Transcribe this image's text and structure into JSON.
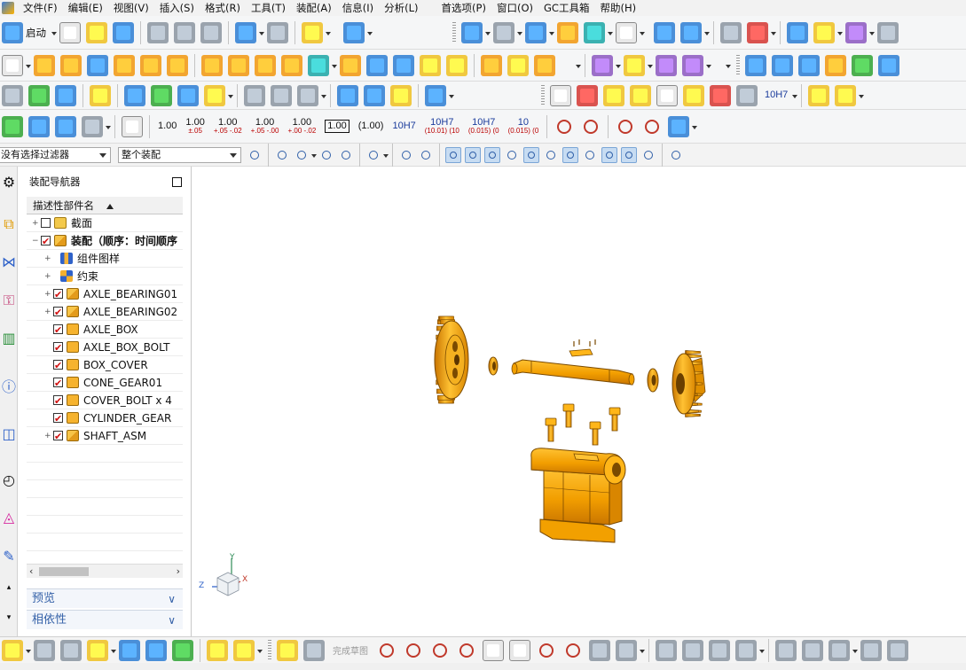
{
  "menu": {
    "items": [
      "文件(F)",
      "编辑(E)",
      "视图(V)",
      "插入(S)",
      "格式(R)",
      "工具(T)",
      "装配(A)",
      "信息(I)",
      "分析(L)",
      "首选项(P)",
      "窗口(O)",
      "GC工具箱",
      "帮助(H)"
    ]
  },
  "toolbar": {
    "start_label": "启动",
    "tolerances": [
      {
        "main": "1.00",
        "sub": ""
      },
      {
        "main": "1.00",
        "sub": "±.05"
      },
      {
        "main": "1.00",
        "sub": "+.05 -.02"
      },
      {
        "main": "1.00",
        "sub": "+.05 -.00"
      },
      {
        "main": "1.00",
        "sub": "+.00 -.02"
      },
      {
        "main": "1.00",
        "sub": "",
        "boxed": true
      },
      {
        "main": "(1.00)",
        "sub": ""
      },
      {
        "main": "10H7",
        "sub": ""
      },
      {
        "main": "10H7",
        "sub": "(10.01) (10"
      },
      {
        "main": "10H7",
        "sub": "(0.015) (0"
      },
      {
        "main": "10",
        "sub": "(0.015) (0"
      }
    ],
    "fit_label": "10H7",
    "sketch_finish_label": "完成草图"
  },
  "filter_bar": {
    "type_filter": "没有选择过滤器",
    "scope": "整个装配"
  },
  "navigator": {
    "title": "装配导航器",
    "column_header": "描述性部件名",
    "rows": [
      {
        "name": "截面",
        "level": 1,
        "expand": "+",
        "checked": false,
        "icon": "folder",
        "bold": false
      },
      {
        "name": "装配（顺序：时间顺序",
        "level": 1,
        "expand": "−",
        "checked": true,
        "icon": "asm",
        "bold": true
      },
      {
        "name": "组件图样",
        "level": 2,
        "expand": "+",
        "checked": null,
        "icon": "pattern",
        "bold": false
      },
      {
        "name": "约束",
        "level": 2,
        "expand": "+",
        "checked": null,
        "icon": "constraint",
        "bold": false
      },
      {
        "name": "AXLE_BEARING01",
        "level": 2,
        "expand": "+",
        "checked": true,
        "icon": "asm",
        "bold": false
      },
      {
        "name": "AXLE_BEARING02",
        "level": 2,
        "expand": "+",
        "checked": true,
        "icon": "asm",
        "bold": false
      },
      {
        "name": "AXLE_BOX",
        "level": 2,
        "expand": "",
        "checked": true,
        "icon": "part",
        "bold": false
      },
      {
        "name": "AXLE_BOX_BOLT",
        "level": 2,
        "expand": "",
        "checked": true,
        "icon": "part",
        "bold": false
      },
      {
        "name": "BOX_COVER",
        "level": 2,
        "expand": "",
        "checked": true,
        "icon": "part",
        "bold": false
      },
      {
        "name": "CONE_GEAR01",
        "level": 2,
        "expand": "",
        "checked": true,
        "icon": "part",
        "bold": false
      },
      {
        "name": "COVER_BOLT x 4",
        "level": 2,
        "expand": "",
        "checked": true,
        "icon": "part",
        "bold": false
      },
      {
        "name": "CYLINDER_GEAR",
        "level": 2,
        "expand": "",
        "checked": true,
        "icon": "part",
        "bold": false
      },
      {
        "name": "SHAFT_ASM",
        "level": 2,
        "expand": "+",
        "checked": true,
        "icon": "asm",
        "bold": false
      }
    ],
    "preview_label": "预览",
    "dependency_label": "相依性"
  },
  "viewport": {
    "triad": {
      "x": "X",
      "y": "Y",
      "z": "Z"
    },
    "part_color": "#f2a000",
    "part_edge_color": "#7a4a00"
  }
}
